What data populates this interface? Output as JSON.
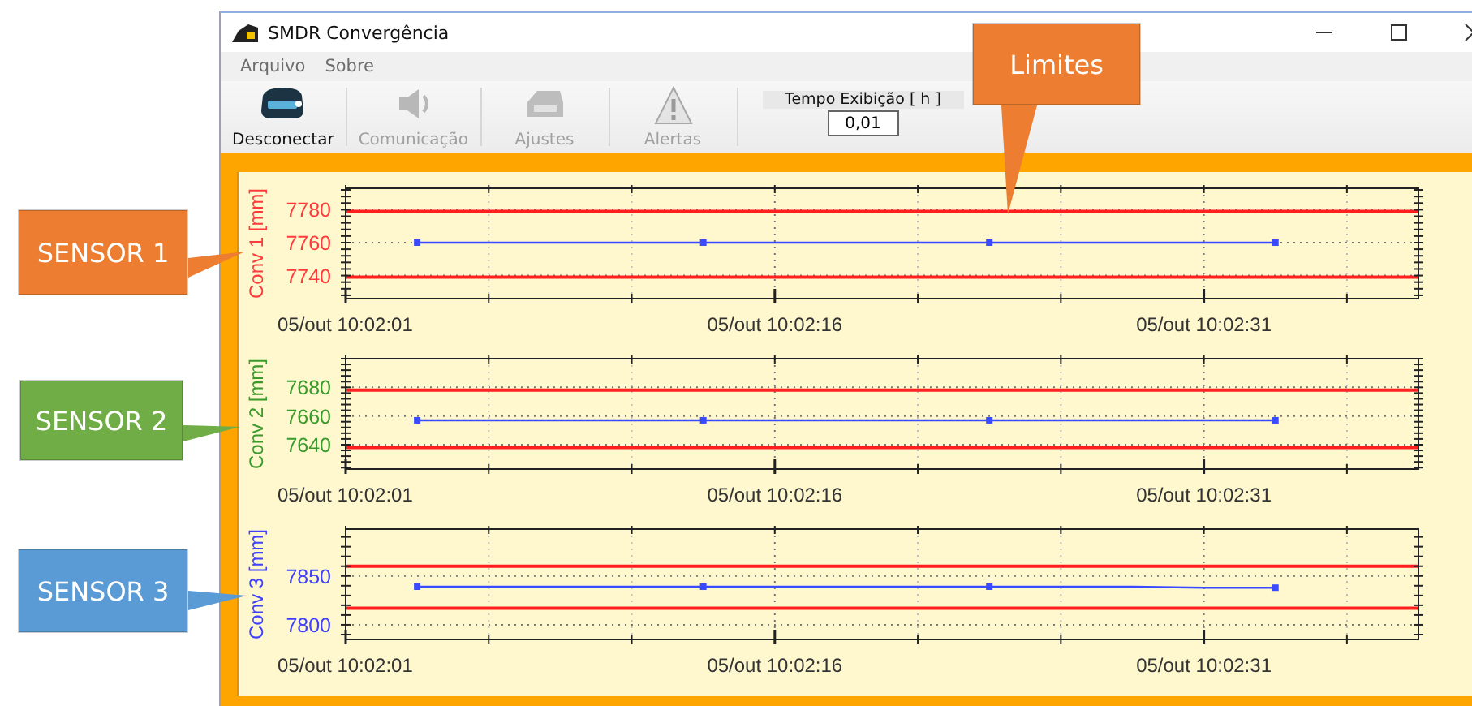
{
  "window": {
    "title": "SMDR Convergência"
  },
  "menu": [
    "Arquivo",
    "Sobre"
  ],
  "toolbar": {
    "buttons": [
      {
        "label": "Desconectar",
        "kind": "device",
        "disabled": false
      },
      {
        "label": "Comunicação",
        "kind": "speaker",
        "disabled": true
      },
      {
        "label": "Ajustes",
        "kind": "machine",
        "disabled": true
      },
      {
        "label": "Alertas",
        "kind": "warning",
        "disabled": true
      }
    ],
    "display_time": {
      "label": "Tempo Exibição [ h ]",
      "value": "0,01"
    }
  },
  "charts": [
    {
      "color": "#ff3b3b",
      "chart_data": {
        "type": "line",
        "ylabel": "Conv 1 [mm]",
        "grid": true,
        "categories": [
          "05/out 10:02:01",
          null,
          null,
          null,
          null,
          null,
          "05/out 10:02:16",
          null,
          null,
          null,
          null,
          null,
          "05/out 10:02:31",
          null,
          null,
          null
        ],
        "ylim": [
          7726,
          7793
        ],
        "yticks": [
          7740,
          7760,
          7780
        ],
        "series": [
          {
            "color": "#3a4bff",
            "values": [
              null,
              7760,
              7760,
              7760,
              7760,
              7760,
              7760,
              7760,
              7760,
              7760,
              7760,
              7760,
              7760,
              7760,
              null,
              null
            ]
          },
          {
            "color": "#ff1f1f",
            "values": [
              7779,
              7779,
              7779,
              7779,
              7779,
              7779,
              7779,
              7779,
              7779,
              7779,
              7779,
              7779,
              7779,
              7779,
              7779,
              7779
            ]
          },
          {
            "color": "#ff1f1f",
            "values": [
              7739,
              7739,
              7739,
              7739,
              7739,
              7739,
              7739,
              7739,
              7739,
              7739,
              7739,
              7739,
              7739,
              7739,
              7739,
              7739
            ]
          }
        ]
      }
    },
    {
      "color": "#3a9a2a",
      "chart_data": {
        "type": "line",
        "ylabel": "Conv 2 [mm]",
        "grid": true,
        "categories": [
          "05/out 10:02:01",
          null,
          null,
          null,
          null,
          null,
          "05/out 10:02:16",
          null,
          null,
          null,
          null,
          null,
          "05/out 10:02:31",
          null,
          null,
          null
        ],
        "ylim": [
          7623,
          7700
        ],
        "yticks": [
          7640,
          7660,
          7680
        ],
        "series": [
          {
            "color": "#3a4bff",
            "values": [
              null,
              7657,
              7657,
              7657,
              7657,
              7657,
              7657,
              7657,
              7657,
              7657,
              7657,
              7657,
              7657,
              7657,
              null,
              null
            ]
          },
          {
            "color": "#ff1f1f",
            "values": [
              7678,
              7678,
              7678,
              7678,
              7678,
              7678,
              7678,
              7678,
              7678,
              7678,
              7678,
              7678,
              7678,
              7678,
              7678,
              7678
            ]
          },
          {
            "color": "#ff1f1f",
            "values": [
              7638,
              7638,
              7638,
              7638,
              7638,
              7638,
              7638,
              7638,
              7638,
              7638,
              7638,
              7638,
              7638,
              7638,
              7638,
              7638
            ]
          }
        ]
      }
    },
    {
      "color": "#4040ff",
      "chart_data": {
        "type": "line",
        "ylabel": "Conv 3 [mm]",
        "grid": true,
        "categories": [
          "05/out 10:02:01",
          null,
          null,
          null,
          null,
          null,
          "05/out 10:02:16",
          null,
          null,
          null,
          null,
          null,
          "05/out 10:02:31",
          null,
          null,
          null
        ],
        "ylim": [
          7785,
          7898
        ],
        "yticks": [
          7800,
          7850
        ],
        "series": [
          {
            "color": "#3a4bff",
            "values": [
              null,
              7839,
              7839,
              7839,
              7839,
              7839,
              7839,
              7839,
              7839,
              7839,
              7839,
              7839,
              7838,
              7838,
              null,
              null
            ]
          },
          {
            "color": "#ff1f1f",
            "values": [
              7860,
              7860,
              7860,
              7860,
              7860,
              7860,
              7860,
              7860,
              7860,
              7860,
              7860,
              7860,
              7860,
              7860,
              7860,
              7860
            ]
          },
          {
            "color": "#ff1f1f",
            "values": [
              7817,
              7817,
              7817,
              7817,
              7817,
              7817,
              7817,
              7817,
              7817,
              7817,
              7817,
              7817,
              7817,
              7817,
              7817,
              7817
            ]
          }
        ]
      }
    }
  ],
  "callouts": [
    {
      "text": "Limites",
      "color": "#ed7d31"
    },
    {
      "text": "SENSOR 1",
      "color": "#ed7d31"
    },
    {
      "text": "SENSOR 2",
      "color": "#70ad47"
    },
    {
      "text": "SENSOR 3",
      "color": "#5b9bd5"
    }
  ]
}
